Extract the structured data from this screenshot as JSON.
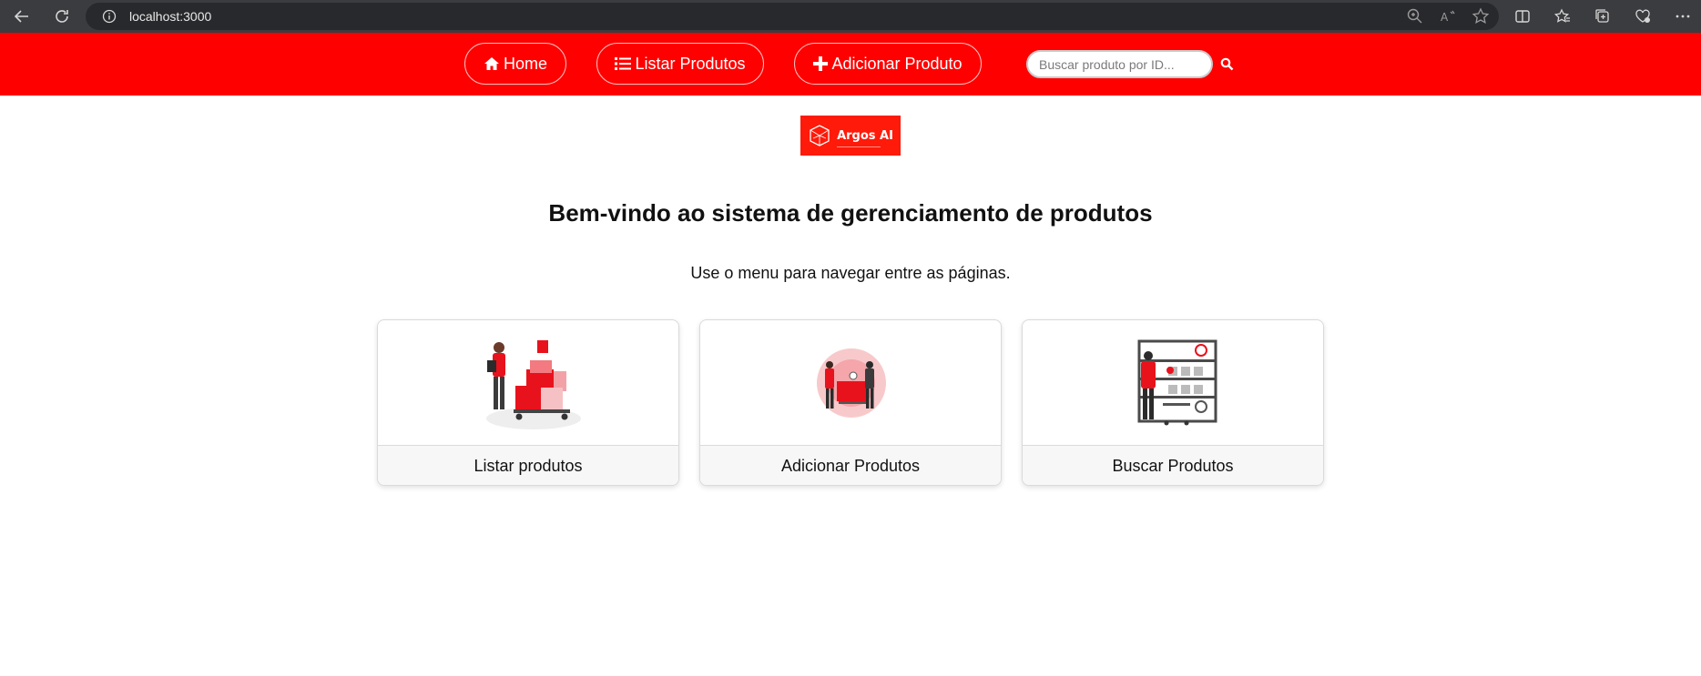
{
  "browser": {
    "url": "localhost:3000"
  },
  "navbar": {
    "home_label": "Home",
    "list_label": "Listar Produtos",
    "add_label": "Adicionar Produto",
    "search_placeholder": "Buscar produto por ID...",
    "background": "#ff0000"
  },
  "logo": {
    "text": "Argos AI"
  },
  "main": {
    "title": "Bem-vindo ao sistema de gerenciamento de produtos",
    "subtitle": "Use o menu para navegar entre as páginas."
  },
  "cards": [
    {
      "label": "Listar produtos"
    },
    {
      "label": "Adicionar Produtos"
    },
    {
      "label": "Buscar Produtos"
    }
  ]
}
